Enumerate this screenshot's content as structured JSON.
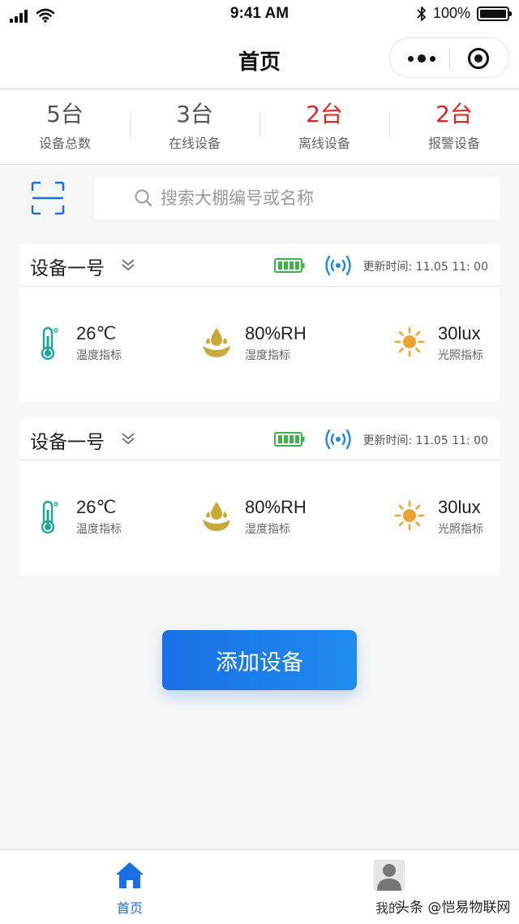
{
  "status_bar": {
    "time": "9:41 AM",
    "battery_text": "100%"
  },
  "nav": {
    "title": "首页"
  },
  "stats": [
    {
      "value": "5台",
      "label": "设备总数",
      "alert": false
    },
    {
      "value": "3台",
      "label": "在线设备",
      "alert": false
    },
    {
      "value": "2台",
      "label": "离线设备",
      "alert": true
    },
    {
      "value": "2台",
      "label": "报警设备",
      "alert": true
    }
  ],
  "search": {
    "placeholder": "搜索大棚编号或名称"
  },
  "devices": [
    {
      "name": "设备一号",
      "update_label": "更新时间: ",
      "update_time": "11.05 11: 00",
      "temperature": {
        "value": "26℃",
        "label": "温度指标"
      },
      "humidity": {
        "value": "80%RH",
        "label": "湿度指标"
      },
      "light": {
        "value": "30lux",
        "label": "光照指标"
      }
    },
    {
      "name": "设备一号",
      "update_label": "更新时间: ",
      "update_time": "11.05 11: 00",
      "temperature": {
        "value": "26℃",
        "label": "温度指标"
      },
      "humidity": {
        "value": "80%RH",
        "label": "湿度指标"
      },
      "light": {
        "value": "30lux",
        "label": "光照指标"
      }
    }
  ],
  "add_button": {
    "label": "添加设备"
  },
  "tabs": [
    {
      "label": "首页",
      "icon": "home-icon",
      "active": true
    },
    {
      "label": "我的",
      "icon": "user-icon",
      "active": false
    }
  ],
  "watermark": "头条 @恺易物联网",
  "colors": {
    "primary": "#1a6fe4",
    "alert": "#e02020",
    "battery": "#3bb54a",
    "signal": "#1e88d8",
    "temperature": "#1aa69a",
    "humidity": "#c9a93a",
    "light": "#f0a22e"
  }
}
